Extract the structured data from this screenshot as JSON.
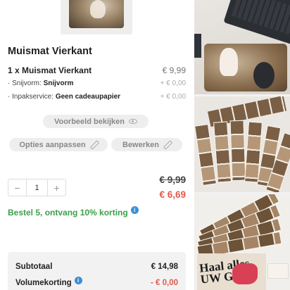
{
  "product": {
    "title": "Muismat Vierkant"
  },
  "line_item": {
    "name": "1 x Muismat Vierkant",
    "price": "€ 9,99",
    "options": [
      {
        "label": "· Snijvorm:",
        "value": "Snijvorm",
        "price": "+ € 0,00"
      },
      {
        "label": "· Inpakservice:",
        "value": "Geen cadeaupapier",
        "price": "+ € 0,00"
      }
    ]
  },
  "actions": {
    "preview_label": "Voorbeeld bekijken",
    "options_label": "Opties aanpassen",
    "edit_label": "Bewerken"
  },
  "quantity": {
    "minus": "−",
    "value": "1",
    "plus": "+"
  },
  "pricing": {
    "old_price": "€ 9,99",
    "new_price": "€ 6,69",
    "discount_text": "Bestel 5, ontvang 10% korting"
  },
  "summary": {
    "subtotal_label": "Subtotaal",
    "subtotal_value": "€ 14,98",
    "volume_label": "Volumekorting",
    "volume_value": "- € 0,00"
  },
  "gallery": {
    "book_text": "Haal alles\nUW GE"
  },
  "colors": {
    "accent_green": "#3aa14a",
    "price_red": "#e05a4a",
    "info_blue": "#3b8fd8"
  },
  "icons": [
    "eye-icon",
    "pencil-icon",
    "info-icon"
  ]
}
